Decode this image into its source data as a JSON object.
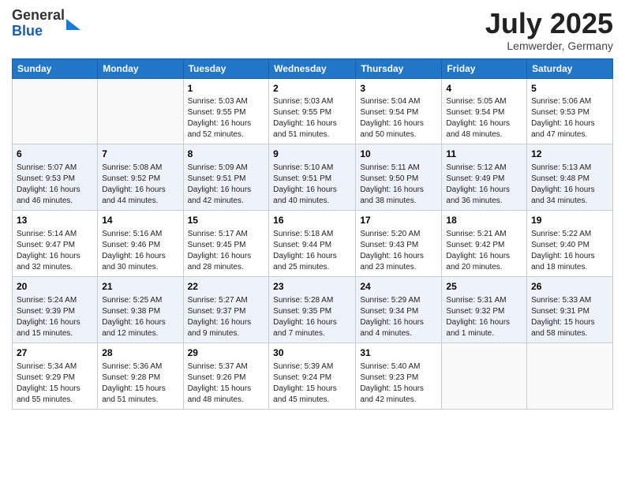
{
  "header": {
    "logo_line1": "General",
    "logo_line2": "Blue",
    "month_title": "July 2025",
    "location": "Lemwerder, Germany"
  },
  "weekdays": [
    "Sunday",
    "Monday",
    "Tuesday",
    "Wednesday",
    "Thursday",
    "Friday",
    "Saturday"
  ],
  "weeks": [
    [
      {
        "day": "",
        "content": ""
      },
      {
        "day": "",
        "content": ""
      },
      {
        "day": "1",
        "content": "Sunrise: 5:03 AM\nSunset: 9:55 PM\nDaylight: 16 hours and 52 minutes."
      },
      {
        "day": "2",
        "content": "Sunrise: 5:03 AM\nSunset: 9:55 PM\nDaylight: 16 hours and 51 minutes."
      },
      {
        "day": "3",
        "content": "Sunrise: 5:04 AM\nSunset: 9:54 PM\nDaylight: 16 hours and 50 minutes."
      },
      {
        "day": "4",
        "content": "Sunrise: 5:05 AM\nSunset: 9:54 PM\nDaylight: 16 hours and 48 minutes."
      },
      {
        "day": "5",
        "content": "Sunrise: 5:06 AM\nSunset: 9:53 PM\nDaylight: 16 hours and 47 minutes."
      }
    ],
    [
      {
        "day": "6",
        "content": "Sunrise: 5:07 AM\nSunset: 9:53 PM\nDaylight: 16 hours and 46 minutes."
      },
      {
        "day": "7",
        "content": "Sunrise: 5:08 AM\nSunset: 9:52 PM\nDaylight: 16 hours and 44 minutes."
      },
      {
        "day": "8",
        "content": "Sunrise: 5:09 AM\nSunset: 9:51 PM\nDaylight: 16 hours and 42 minutes."
      },
      {
        "day": "9",
        "content": "Sunrise: 5:10 AM\nSunset: 9:51 PM\nDaylight: 16 hours and 40 minutes."
      },
      {
        "day": "10",
        "content": "Sunrise: 5:11 AM\nSunset: 9:50 PM\nDaylight: 16 hours and 38 minutes."
      },
      {
        "day": "11",
        "content": "Sunrise: 5:12 AM\nSunset: 9:49 PM\nDaylight: 16 hours and 36 minutes."
      },
      {
        "day": "12",
        "content": "Sunrise: 5:13 AM\nSunset: 9:48 PM\nDaylight: 16 hours and 34 minutes."
      }
    ],
    [
      {
        "day": "13",
        "content": "Sunrise: 5:14 AM\nSunset: 9:47 PM\nDaylight: 16 hours and 32 minutes."
      },
      {
        "day": "14",
        "content": "Sunrise: 5:16 AM\nSunset: 9:46 PM\nDaylight: 16 hours and 30 minutes."
      },
      {
        "day": "15",
        "content": "Sunrise: 5:17 AM\nSunset: 9:45 PM\nDaylight: 16 hours and 28 minutes."
      },
      {
        "day": "16",
        "content": "Sunrise: 5:18 AM\nSunset: 9:44 PM\nDaylight: 16 hours and 25 minutes."
      },
      {
        "day": "17",
        "content": "Sunrise: 5:20 AM\nSunset: 9:43 PM\nDaylight: 16 hours and 23 minutes."
      },
      {
        "day": "18",
        "content": "Sunrise: 5:21 AM\nSunset: 9:42 PM\nDaylight: 16 hours and 20 minutes."
      },
      {
        "day": "19",
        "content": "Sunrise: 5:22 AM\nSunset: 9:40 PM\nDaylight: 16 hours and 18 minutes."
      }
    ],
    [
      {
        "day": "20",
        "content": "Sunrise: 5:24 AM\nSunset: 9:39 PM\nDaylight: 16 hours and 15 minutes."
      },
      {
        "day": "21",
        "content": "Sunrise: 5:25 AM\nSunset: 9:38 PM\nDaylight: 16 hours and 12 minutes."
      },
      {
        "day": "22",
        "content": "Sunrise: 5:27 AM\nSunset: 9:37 PM\nDaylight: 16 hours and 9 minutes."
      },
      {
        "day": "23",
        "content": "Sunrise: 5:28 AM\nSunset: 9:35 PM\nDaylight: 16 hours and 7 minutes."
      },
      {
        "day": "24",
        "content": "Sunrise: 5:29 AM\nSunset: 9:34 PM\nDaylight: 16 hours and 4 minutes."
      },
      {
        "day": "25",
        "content": "Sunrise: 5:31 AM\nSunset: 9:32 PM\nDaylight: 16 hours and 1 minute."
      },
      {
        "day": "26",
        "content": "Sunrise: 5:33 AM\nSunset: 9:31 PM\nDaylight: 15 hours and 58 minutes."
      }
    ],
    [
      {
        "day": "27",
        "content": "Sunrise: 5:34 AM\nSunset: 9:29 PM\nDaylight: 15 hours and 55 minutes."
      },
      {
        "day": "28",
        "content": "Sunrise: 5:36 AM\nSunset: 9:28 PM\nDaylight: 15 hours and 51 minutes."
      },
      {
        "day": "29",
        "content": "Sunrise: 5:37 AM\nSunset: 9:26 PM\nDaylight: 15 hours and 48 minutes."
      },
      {
        "day": "30",
        "content": "Sunrise: 5:39 AM\nSunset: 9:24 PM\nDaylight: 15 hours and 45 minutes."
      },
      {
        "day": "31",
        "content": "Sunrise: 5:40 AM\nSunset: 9:23 PM\nDaylight: 15 hours and 42 minutes."
      },
      {
        "day": "",
        "content": ""
      },
      {
        "day": "",
        "content": ""
      }
    ]
  ]
}
